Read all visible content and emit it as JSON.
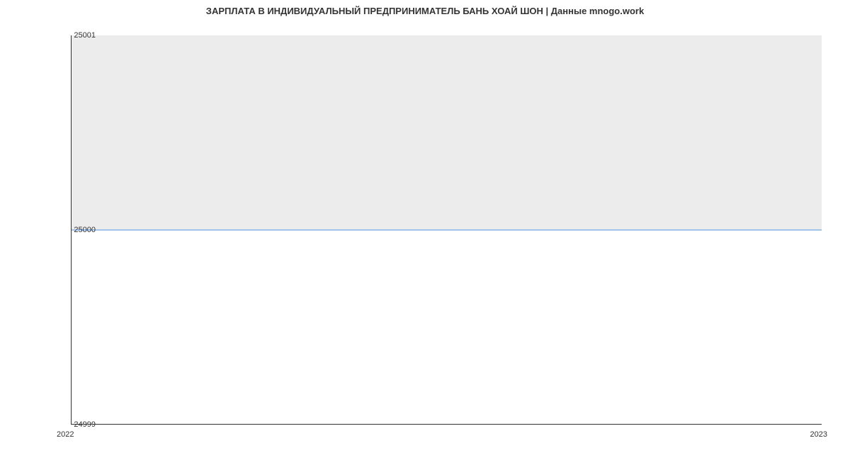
{
  "chart_data": {
    "type": "line",
    "title": "ЗАРПЛАТА В ИНДИВИДУАЛЬНЫЙ ПРЕДПРИНИМАТЕЛЬ БАНЬ ХОАЙ ШОН | Данные mnogo.work",
    "x": [
      2022,
      2023
    ],
    "values": [
      25000,
      25000
    ],
    "xlabel": "",
    "ylabel": "",
    "ylim": [
      24999,
      25001
    ],
    "xlim": [
      2022,
      2023
    ],
    "y_ticks": [
      24999,
      25000,
      25001
    ],
    "x_ticks": [
      2022,
      2023
    ],
    "y_tick_labels": {
      "top": "25001",
      "mid": "25000",
      "bottom": "24999"
    },
    "x_tick_labels": {
      "left": "2022",
      "right": "2023"
    }
  }
}
